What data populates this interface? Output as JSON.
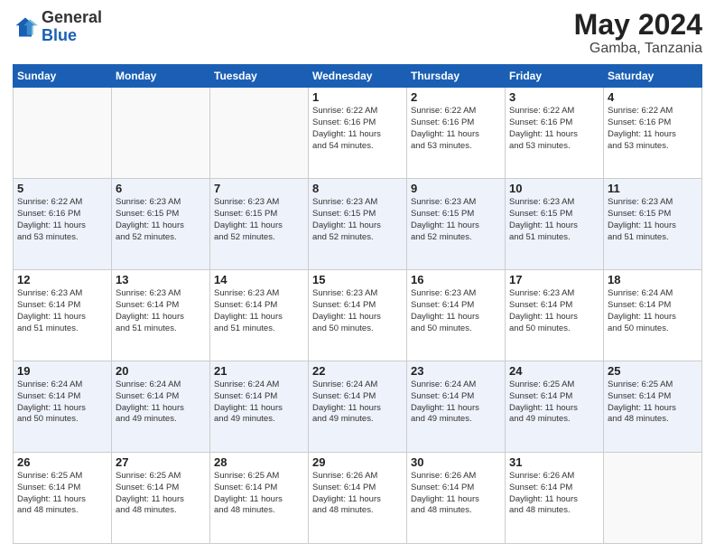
{
  "header": {
    "logo_general": "General",
    "logo_blue": "Blue",
    "month_year": "May 2024",
    "location": "Gamba, Tanzania"
  },
  "weekdays": [
    "Sunday",
    "Monday",
    "Tuesday",
    "Wednesday",
    "Thursday",
    "Friday",
    "Saturday"
  ],
  "weeks": [
    [
      {
        "day": "",
        "info": ""
      },
      {
        "day": "",
        "info": ""
      },
      {
        "day": "",
        "info": ""
      },
      {
        "day": "1",
        "info": "Sunrise: 6:22 AM\nSunset: 6:16 PM\nDaylight: 11 hours\nand 54 minutes."
      },
      {
        "day": "2",
        "info": "Sunrise: 6:22 AM\nSunset: 6:16 PM\nDaylight: 11 hours\nand 53 minutes."
      },
      {
        "day": "3",
        "info": "Sunrise: 6:22 AM\nSunset: 6:16 PM\nDaylight: 11 hours\nand 53 minutes."
      },
      {
        "day": "4",
        "info": "Sunrise: 6:22 AM\nSunset: 6:16 PM\nDaylight: 11 hours\nand 53 minutes."
      }
    ],
    [
      {
        "day": "5",
        "info": "Sunrise: 6:22 AM\nSunset: 6:16 PM\nDaylight: 11 hours\nand 53 minutes."
      },
      {
        "day": "6",
        "info": "Sunrise: 6:23 AM\nSunset: 6:15 PM\nDaylight: 11 hours\nand 52 minutes."
      },
      {
        "day": "7",
        "info": "Sunrise: 6:23 AM\nSunset: 6:15 PM\nDaylight: 11 hours\nand 52 minutes."
      },
      {
        "day": "8",
        "info": "Sunrise: 6:23 AM\nSunset: 6:15 PM\nDaylight: 11 hours\nand 52 minutes."
      },
      {
        "day": "9",
        "info": "Sunrise: 6:23 AM\nSunset: 6:15 PM\nDaylight: 11 hours\nand 52 minutes."
      },
      {
        "day": "10",
        "info": "Sunrise: 6:23 AM\nSunset: 6:15 PM\nDaylight: 11 hours\nand 51 minutes."
      },
      {
        "day": "11",
        "info": "Sunrise: 6:23 AM\nSunset: 6:15 PM\nDaylight: 11 hours\nand 51 minutes."
      }
    ],
    [
      {
        "day": "12",
        "info": "Sunrise: 6:23 AM\nSunset: 6:14 PM\nDaylight: 11 hours\nand 51 minutes."
      },
      {
        "day": "13",
        "info": "Sunrise: 6:23 AM\nSunset: 6:14 PM\nDaylight: 11 hours\nand 51 minutes."
      },
      {
        "day": "14",
        "info": "Sunrise: 6:23 AM\nSunset: 6:14 PM\nDaylight: 11 hours\nand 51 minutes."
      },
      {
        "day": "15",
        "info": "Sunrise: 6:23 AM\nSunset: 6:14 PM\nDaylight: 11 hours\nand 50 minutes."
      },
      {
        "day": "16",
        "info": "Sunrise: 6:23 AM\nSunset: 6:14 PM\nDaylight: 11 hours\nand 50 minutes."
      },
      {
        "day": "17",
        "info": "Sunrise: 6:23 AM\nSunset: 6:14 PM\nDaylight: 11 hours\nand 50 minutes."
      },
      {
        "day": "18",
        "info": "Sunrise: 6:24 AM\nSunset: 6:14 PM\nDaylight: 11 hours\nand 50 minutes."
      }
    ],
    [
      {
        "day": "19",
        "info": "Sunrise: 6:24 AM\nSunset: 6:14 PM\nDaylight: 11 hours\nand 50 minutes."
      },
      {
        "day": "20",
        "info": "Sunrise: 6:24 AM\nSunset: 6:14 PM\nDaylight: 11 hours\nand 49 minutes."
      },
      {
        "day": "21",
        "info": "Sunrise: 6:24 AM\nSunset: 6:14 PM\nDaylight: 11 hours\nand 49 minutes."
      },
      {
        "day": "22",
        "info": "Sunrise: 6:24 AM\nSunset: 6:14 PM\nDaylight: 11 hours\nand 49 minutes."
      },
      {
        "day": "23",
        "info": "Sunrise: 6:24 AM\nSunset: 6:14 PM\nDaylight: 11 hours\nand 49 minutes."
      },
      {
        "day": "24",
        "info": "Sunrise: 6:25 AM\nSunset: 6:14 PM\nDaylight: 11 hours\nand 49 minutes."
      },
      {
        "day": "25",
        "info": "Sunrise: 6:25 AM\nSunset: 6:14 PM\nDaylight: 11 hours\nand 48 minutes."
      }
    ],
    [
      {
        "day": "26",
        "info": "Sunrise: 6:25 AM\nSunset: 6:14 PM\nDaylight: 11 hours\nand 48 minutes."
      },
      {
        "day": "27",
        "info": "Sunrise: 6:25 AM\nSunset: 6:14 PM\nDaylight: 11 hours\nand 48 minutes."
      },
      {
        "day": "28",
        "info": "Sunrise: 6:25 AM\nSunset: 6:14 PM\nDaylight: 11 hours\nand 48 minutes."
      },
      {
        "day": "29",
        "info": "Sunrise: 6:26 AM\nSunset: 6:14 PM\nDaylight: 11 hours\nand 48 minutes."
      },
      {
        "day": "30",
        "info": "Sunrise: 6:26 AM\nSunset: 6:14 PM\nDaylight: 11 hours\nand 48 minutes."
      },
      {
        "day": "31",
        "info": "Sunrise: 6:26 AM\nSunset: 6:14 PM\nDaylight: 11 hours\nand 48 minutes."
      },
      {
        "day": "",
        "info": ""
      }
    ]
  ]
}
